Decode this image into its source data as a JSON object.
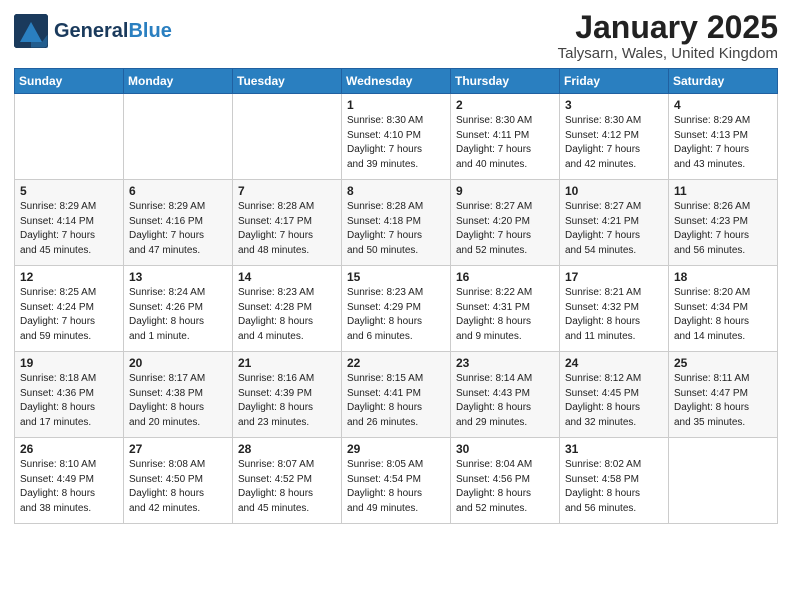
{
  "header": {
    "logo": {
      "general": "General",
      "blue": "Blue"
    },
    "title": "January 2025",
    "location": "Talysarn, Wales, United Kingdom"
  },
  "weekdays": [
    "Sunday",
    "Monday",
    "Tuesday",
    "Wednesday",
    "Thursday",
    "Friday",
    "Saturday"
  ],
  "weeks": [
    [
      {
        "day": "",
        "info": ""
      },
      {
        "day": "",
        "info": ""
      },
      {
        "day": "",
        "info": ""
      },
      {
        "day": "1",
        "info": "Sunrise: 8:30 AM\nSunset: 4:10 PM\nDaylight: 7 hours\nand 39 minutes."
      },
      {
        "day": "2",
        "info": "Sunrise: 8:30 AM\nSunset: 4:11 PM\nDaylight: 7 hours\nand 40 minutes."
      },
      {
        "day": "3",
        "info": "Sunrise: 8:30 AM\nSunset: 4:12 PM\nDaylight: 7 hours\nand 42 minutes."
      },
      {
        "day": "4",
        "info": "Sunrise: 8:29 AM\nSunset: 4:13 PM\nDaylight: 7 hours\nand 43 minutes."
      }
    ],
    [
      {
        "day": "5",
        "info": "Sunrise: 8:29 AM\nSunset: 4:14 PM\nDaylight: 7 hours\nand 45 minutes."
      },
      {
        "day": "6",
        "info": "Sunrise: 8:29 AM\nSunset: 4:16 PM\nDaylight: 7 hours\nand 47 minutes."
      },
      {
        "day": "7",
        "info": "Sunrise: 8:28 AM\nSunset: 4:17 PM\nDaylight: 7 hours\nand 48 minutes."
      },
      {
        "day": "8",
        "info": "Sunrise: 8:28 AM\nSunset: 4:18 PM\nDaylight: 7 hours\nand 50 minutes."
      },
      {
        "day": "9",
        "info": "Sunrise: 8:27 AM\nSunset: 4:20 PM\nDaylight: 7 hours\nand 52 minutes."
      },
      {
        "day": "10",
        "info": "Sunrise: 8:27 AM\nSunset: 4:21 PM\nDaylight: 7 hours\nand 54 minutes."
      },
      {
        "day": "11",
        "info": "Sunrise: 8:26 AM\nSunset: 4:23 PM\nDaylight: 7 hours\nand 56 minutes."
      }
    ],
    [
      {
        "day": "12",
        "info": "Sunrise: 8:25 AM\nSunset: 4:24 PM\nDaylight: 7 hours\nand 59 minutes."
      },
      {
        "day": "13",
        "info": "Sunrise: 8:24 AM\nSunset: 4:26 PM\nDaylight: 8 hours\nand 1 minute."
      },
      {
        "day": "14",
        "info": "Sunrise: 8:23 AM\nSunset: 4:28 PM\nDaylight: 8 hours\nand 4 minutes."
      },
      {
        "day": "15",
        "info": "Sunrise: 8:23 AM\nSunset: 4:29 PM\nDaylight: 8 hours\nand 6 minutes."
      },
      {
        "day": "16",
        "info": "Sunrise: 8:22 AM\nSunset: 4:31 PM\nDaylight: 8 hours\nand 9 minutes."
      },
      {
        "day": "17",
        "info": "Sunrise: 8:21 AM\nSunset: 4:32 PM\nDaylight: 8 hours\nand 11 minutes."
      },
      {
        "day": "18",
        "info": "Sunrise: 8:20 AM\nSunset: 4:34 PM\nDaylight: 8 hours\nand 14 minutes."
      }
    ],
    [
      {
        "day": "19",
        "info": "Sunrise: 8:18 AM\nSunset: 4:36 PM\nDaylight: 8 hours\nand 17 minutes."
      },
      {
        "day": "20",
        "info": "Sunrise: 8:17 AM\nSunset: 4:38 PM\nDaylight: 8 hours\nand 20 minutes."
      },
      {
        "day": "21",
        "info": "Sunrise: 8:16 AM\nSunset: 4:39 PM\nDaylight: 8 hours\nand 23 minutes."
      },
      {
        "day": "22",
        "info": "Sunrise: 8:15 AM\nSunset: 4:41 PM\nDaylight: 8 hours\nand 26 minutes."
      },
      {
        "day": "23",
        "info": "Sunrise: 8:14 AM\nSunset: 4:43 PM\nDaylight: 8 hours\nand 29 minutes."
      },
      {
        "day": "24",
        "info": "Sunrise: 8:12 AM\nSunset: 4:45 PM\nDaylight: 8 hours\nand 32 minutes."
      },
      {
        "day": "25",
        "info": "Sunrise: 8:11 AM\nSunset: 4:47 PM\nDaylight: 8 hours\nand 35 minutes."
      }
    ],
    [
      {
        "day": "26",
        "info": "Sunrise: 8:10 AM\nSunset: 4:49 PM\nDaylight: 8 hours\nand 38 minutes."
      },
      {
        "day": "27",
        "info": "Sunrise: 8:08 AM\nSunset: 4:50 PM\nDaylight: 8 hours\nand 42 minutes."
      },
      {
        "day": "28",
        "info": "Sunrise: 8:07 AM\nSunset: 4:52 PM\nDaylight: 8 hours\nand 45 minutes."
      },
      {
        "day": "29",
        "info": "Sunrise: 8:05 AM\nSunset: 4:54 PM\nDaylight: 8 hours\nand 49 minutes."
      },
      {
        "day": "30",
        "info": "Sunrise: 8:04 AM\nSunset: 4:56 PM\nDaylight: 8 hours\nand 52 minutes."
      },
      {
        "day": "31",
        "info": "Sunrise: 8:02 AM\nSunset: 4:58 PM\nDaylight: 8 hours\nand 56 minutes."
      },
      {
        "day": "",
        "info": ""
      }
    ]
  ]
}
